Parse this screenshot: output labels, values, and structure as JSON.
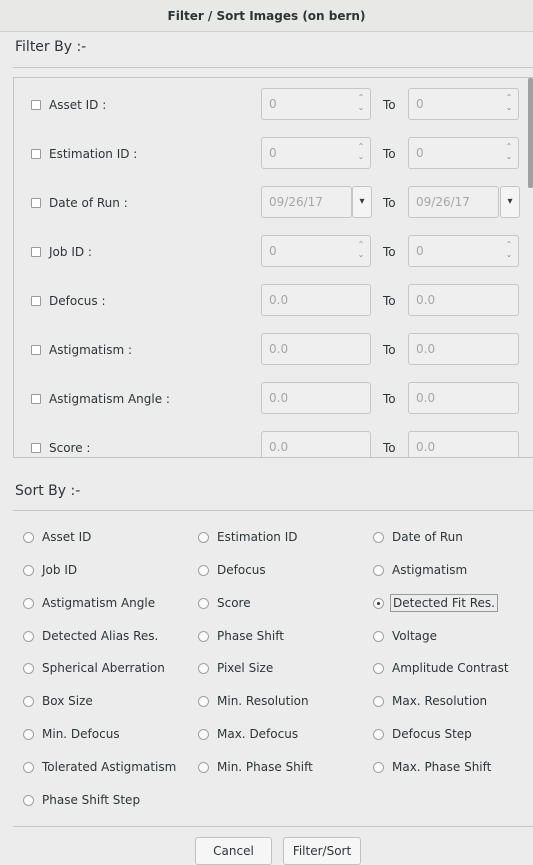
{
  "window": {
    "title": "Filter / Sort Images (on bern)"
  },
  "filter": {
    "heading": "Filter By :-",
    "to_label": "To",
    "rows": [
      {
        "label": "Asset ID :",
        "from": "0",
        "to": "0",
        "type": "spin"
      },
      {
        "label": "Estimation ID :",
        "from": "0",
        "to": "0",
        "type": "spin"
      },
      {
        "label": "Date of Run :",
        "from": "09/26/17",
        "to": "09/26/17",
        "type": "date"
      },
      {
        "label": "Job ID :",
        "from": "0",
        "to": "0",
        "type": "spin"
      },
      {
        "label": "Defocus :",
        "from": "0.0",
        "to": "0.0",
        "type": "text"
      },
      {
        "label": "Astigmatism :",
        "from": "0.0",
        "to": "0.0",
        "type": "text"
      },
      {
        "label": "Astigmatism Angle :",
        "from": "0.0",
        "to": "0.0",
        "type": "text"
      },
      {
        "label": "Score :",
        "from": "0.0",
        "to": "0.0",
        "type": "text"
      }
    ]
  },
  "sort": {
    "heading": "Sort By :-",
    "selected": "Detected Fit Res.",
    "options": [
      "Asset ID",
      "Estimation ID",
      "Date of Run",
      "Job ID",
      "Defocus",
      "Astigmatism",
      "Astigmatism Angle",
      "Score",
      "Detected Fit Res.",
      "Detected Alias Res.",
      "Phase Shift",
      "Voltage",
      "Spherical Aberration",
      "Pixel Size",
      "Amplitude Contrast",
      "Box Size",
      "Min. Resolution",
      "Max. Resolution",
      "Min. Defocus",
      "Max. Defocus",
      "Defocus Step",
      "Tolerated Astigmatism",
      "Min. Phase Shift",
      "Max. Phase Shift",
      "Phase Shift Step"
    ]
  },
  "buttons": {
    "cancel": "Cancel",
    "filter_sort": "Filter/Sort"
  },
  "icons": {
    "spin_up": "▲",
    "spin_down": "▼",
    "dropdown": "chevron-down"
  }
}
